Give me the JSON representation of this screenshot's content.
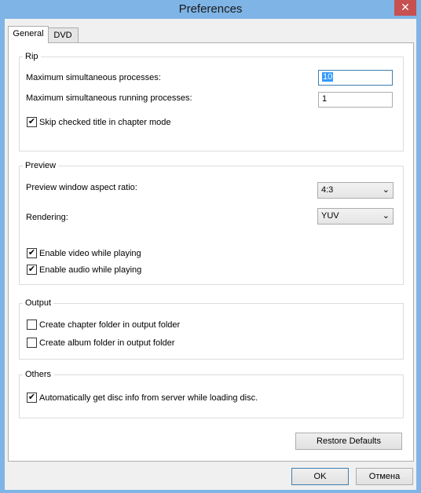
{
  "window": {
    "title": "Preferences",
    "close_glyph": "✕"
  },
  "tabs": [
    {
      "label": "General"
    },
    {
      "label": "DVD"
    }
  ],
  "rip": {
    "label": "Rip",
    "max_processes_label": "Maximum simultaneous processes:",
    "max_processes_value": "10",
    "max_running_label": "Maximum simultaneous running processes:",
    "max_running_value": "1",
    "skip_checked_label": "Skip checked title in chapter mode",
    "skip_checked": true
  },
  "preview": {
    "label": "Preview",
    "aspect_label": "Preview window aspect ratio:",
    "aspect_value": "4:3",
    "rendering_label": "Rendering:",
    "rendering_value": "YUV",
    "enable_video_label": "Enable video while playing",
    "enable_video": true,
    "enable_audio_label": "Enable audio while playing",
    "enable_audio": true
  },
  "output": {
    "label": "Output",
    "chapter_folder_label": "Create chapter folder in output folder",
    "chapter_folder": false,
    "album_folder_label": "Create album folder in output folder",
    "album_folder": false
  },
  "others": {
    "label": "Others",
    "auto_disc_info_label": "Automatically get disc info from server while loading disc.",
    "auto_disc_info": true
  },
  "buttons": {
    "restore_defaults": "Restore Defaults",
    "ok": "OK",
    "cancel": "Отмена"
  },
  "glyphs": {
    "check": "✔",
    "dropdown": "⌄"
  }
}
